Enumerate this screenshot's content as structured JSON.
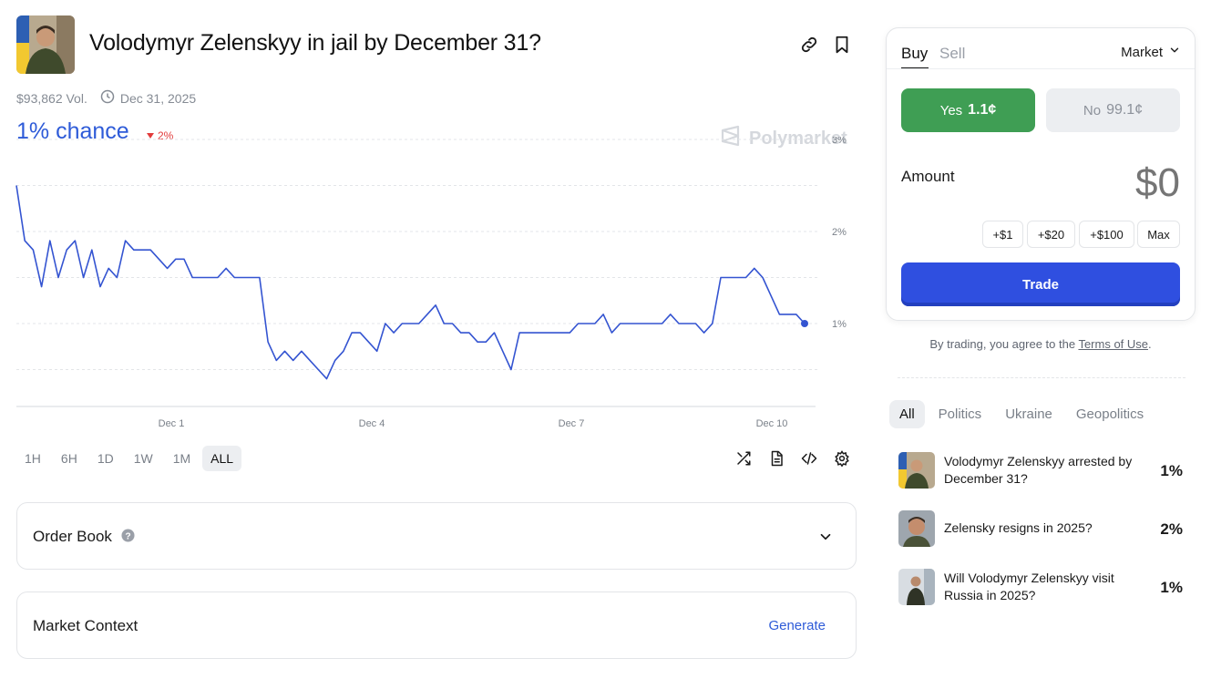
{
  "market": {
    "title": "Volodymyr Zelenskyy in jail by December 31?",
    "volume": "$93,862 Vol.",
    "end_date": "Dec 31, 2025",
    "chance": "1% chance",
    "change": "2%",
    "watermark": "Polymarket"
  },
  "icons": {
    "link": "link-icon",
    "bookmark": "bookmark-icon",
    "clock": "clock-icon",
    "shuffle": "shuffle-icon",
    "document": "document-icon",
    "embed": "code-icon",
    "settings": "gear-icon",
    "help": "help-icon",
    "chevron": "chevron-down-icon"
  },
  "chart_data": {
    "type": "line",
    "title": "",
    "xlabel": "",
    "ylabel": "",
    "x_tick_labels": [
      "Dec 1",
      "Dec 4",
      "Dec 7",
      "Dec 10"
    ],
    "y_tick_labels": [
      "1%",
      "2%",
      "3%"
    ],
    "ylim": [
      0,
      3
    ],
    "grid": true,
    "color": "#3454d1",
    "series": [
      {
        "values": [
          2.5,
          1.9,
          1.8,
          1.4,
          1.9,
          1.5,
          1.8,
          1.9,
          1.5,
          1.8,
          1.4,
          1.6,
          1.5,
          1.9,
          1.8,
          1.8,
          1.8,
          1.7,
          1.6,
          1.7,
          1.7,
          1.5,
          1.5,
          1.5,
          1.5,
          1.6,
          1.5,
          1.5,
          1.5,
          1.5,
          0.8,
          0.6,
          0.7,
          0.6,
          0.7,
          0.6,
          0.5,
          0.4,
          0.6,
          0.7,
          0.9,
          0.9,
          0.8,
          0.7,
          1.0,
          0.9,
          1.0,
          1.0,
          1.0,
          1.1,
          1.2,
          1.0,
          1.0,
          0.9,
          0.9,
          0.8,
          0.8,
          0.9,
          0.7,
          0.5,
          0.9,
          0.9,
          0.9,
          0.9,
          0.9,
          0.9,
          0.9,
          1.0,
          1.0,
          1.0,
          1.1,
          0.9,
          1.0,
          1.0,
          1.0,
          1.0,
          1.0,
          1.0,
          1.1,
          1.0,
          1.0,
          1.0,
          0.9,
          1.0,
          1.5,
          1.5,
          1.5,
          1.5,
          1.6,
          1.5,
          1.3,
          1.1,
          1.1,
          1.1,
          1.0
        ]
      }
    ]
  },
  "time_ranges": [
    "1H",
    "6H",
    "1D",
    "1W",
    "1M",
    "ALL"
  ],
  "active_range": "ALL",
  "order_book": {
    "label": "Order Book"
  },
  "market_context": {
    "label": "Market Context",
    "action": "Generate"
  },
  "trade": {
    "tab_buy": "Buy",
    "tab_sell": "Sell",
    "order_type": "Market",
    "yes_label": "Yes",
    "yes_price": "1.1¢",
    "no_label": "No",
    "no_price": "99.1¢",
    "amount_label": "Amount",
    "amount_value": "$0",
    "quick_1": "+$1",
    "quick_20": "+$20",
    "quick_100": "+$100",
    "quick_max": "Max",
    "submit": "Trade",
    "terms_prefix": "By trading, you agree to the ",
    "terms_link": "Terms of Use",
    "terms_suffix": "."
  },
  "categories": [
    "All",
    "Politics",
    "Ukraine",
    "Geopolitics"
  ],
  "related": [
    {
      "text": "Volodymyr Zelenskyy arrested by December 31?",
      "pct": "1%"
    },
    {
      "text": "Zelensky resigns in 2025?",
      "pct": "2%"
    },
    {
      "text": "Will Volodymyr Zelenskyy visit Russia in 2025?",
      "pct": "1%"
    }
  ],
  "colors": {
    "accent": "#2e5bd8",
    "yes": "#3f9e54",
    "trade": "#2f4fe0",
    "down": "#e23b3b"
  }
}
